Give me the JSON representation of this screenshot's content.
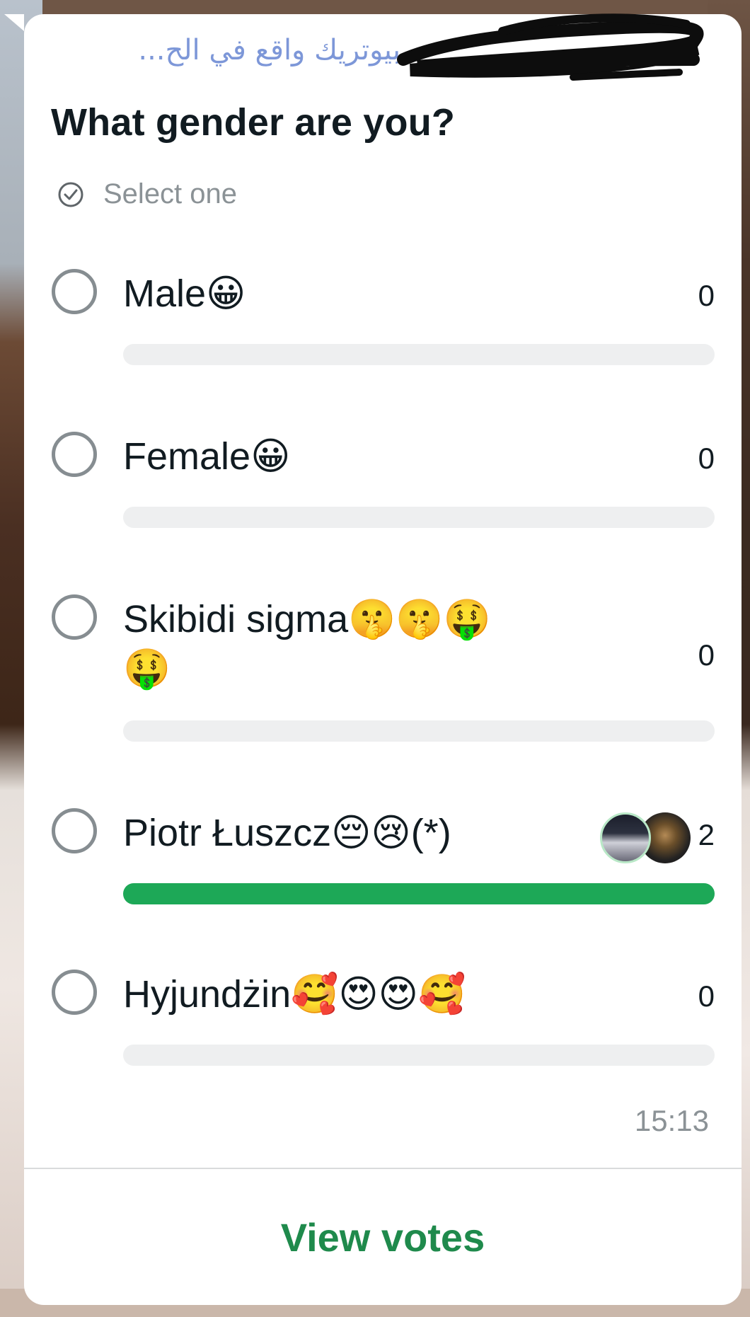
{
  "message": {
    "sender_preview": "بيوتريك واقع في الح...",
    "question": "What gender are you?",
    "hint_icon": "check-circle-icon",
    "hint": "Select one",
    "timestamp": "15:13",
    "view_votes_label": "View votes"
  },
  "poll": {
    "options": [
      {
        "label": "Male",
        "emoji": "😀",
        "count": "0",
        "fraction": 0
      },
      {
        "label": "Female",
        "emoji": "😀",
        "count": "0",
        "fraction": 0
      },
      {
        "label": "Skibidi sigma",
        "emoji": "🤫🤫🤑",
        "emoji_line2": "🤑",
        "count": "0",
        "fraction": 0
      },
      {
        "label": "Piotr Łuszcz",
        "emoji": "😔😢",
        "suffix": "(*)",
        "count": "2",
        "fraction": 1,
        "voter_avatars": [
          "avatar-night-sky",
          "avatar-statue"
        ]
      },
      {
        "label": "Hyjundżin",
        "emoji": "🥰😍😍🥰",
        "count": "0",
        "fraction": 0
      }
    ]
  },
  "colors": {
    "accent_green": "#1da857",
    "view_votes_green": "#1f8a4c",
    "sender_blue": "#7d97d8",
    "track_gray": "#eeeff0"
  }
}
